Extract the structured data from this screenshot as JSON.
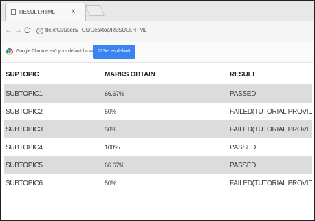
{
  "browser": {
    "tab_title": "RESULT.HTML",
    "tab_close": "x",
    "address": "file:///C:/Users/TCS/Desktop/RESULT.HTML",
    "info_icon": "i",
    "infobar_text": "Google Chrome isn't your default browser",
    "default_button_label": "Set as default",
    "accent_color": "#3b83f0"
  },
  "table": {
    "headers": [
      "SUPTOPIC",
      "MARKS OBTAIN",
      "RESULT"
    ],
    "rows": [
      [
        "SUBTOPIC1",
        "66.67%",
        "PASSED"
      ],
      [
        "SUBTOPIC2",
        "50%",
        "FAILED(TUTORIAL PROVIDED)"
      ],
      [
        "SUBTOPIC3",
        "50%",
        "FAILED(TUTORIAL PROVIDED)"
      ],
      [
        "SUBTOPIC4",
        "100%",
        "PASSED"
      ],
      [
        "SUBTOPIC5",
        "66.67%",
        "PASSED"
      ],
      [
        "SUBTOPIC6",
        "50%",
        "FAILED(TUTORIAL PROVIDED)"
      ]
    ],
    "row_stripe_color": "#dcdcdc"
  }
}
